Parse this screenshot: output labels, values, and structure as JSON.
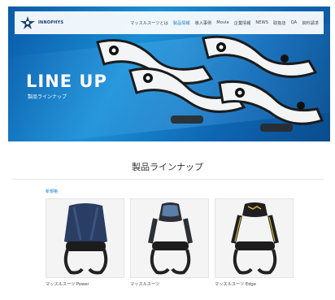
{
  "header": {
    "logo_text": "INNOPHYS",
    "nav": [
      {
        "label": "マッスルスーツとは",
        "active": false
      },
      {
        "label": "製品情報",
        "active": true
      },
      {
        "label": "導入事例",
        "active": false
      },
      {
        "label": "Movie",
        "active": false
      },
      {
        "label": "企業情報",
        "active": false
      },
      {
        "label": "NEWS",
        "active": false
      },
      {
        "label": "取扱店",
        "active": false
      },
      {
        "label": "QA",
        "active": false
      },
      {
        "label": "資料請求",
        "active": false
      }
    ]
  },
  "hero": {
    "title": "LINE UP",
    "subtitle": "製品ラインナップ"
  },
  "section": {
    "title": "製品ラインナップ",
    "category": "新規格"
  },
  "products": [
    {
      "name": "マッスルスーツ Power",
      "color": "#2a3d62"
    },
    {
      "name": "マッスルスーツ",
      "color": "#2d2f36"
    },
    {
      "name": "マッスルスーツ Edge",
      "color": "#1f1f22"
    }
  ],
  "colors": {
    "accent": "#1a7fd0",
    "hero_blue": "#1a8fd6"
  }
}
